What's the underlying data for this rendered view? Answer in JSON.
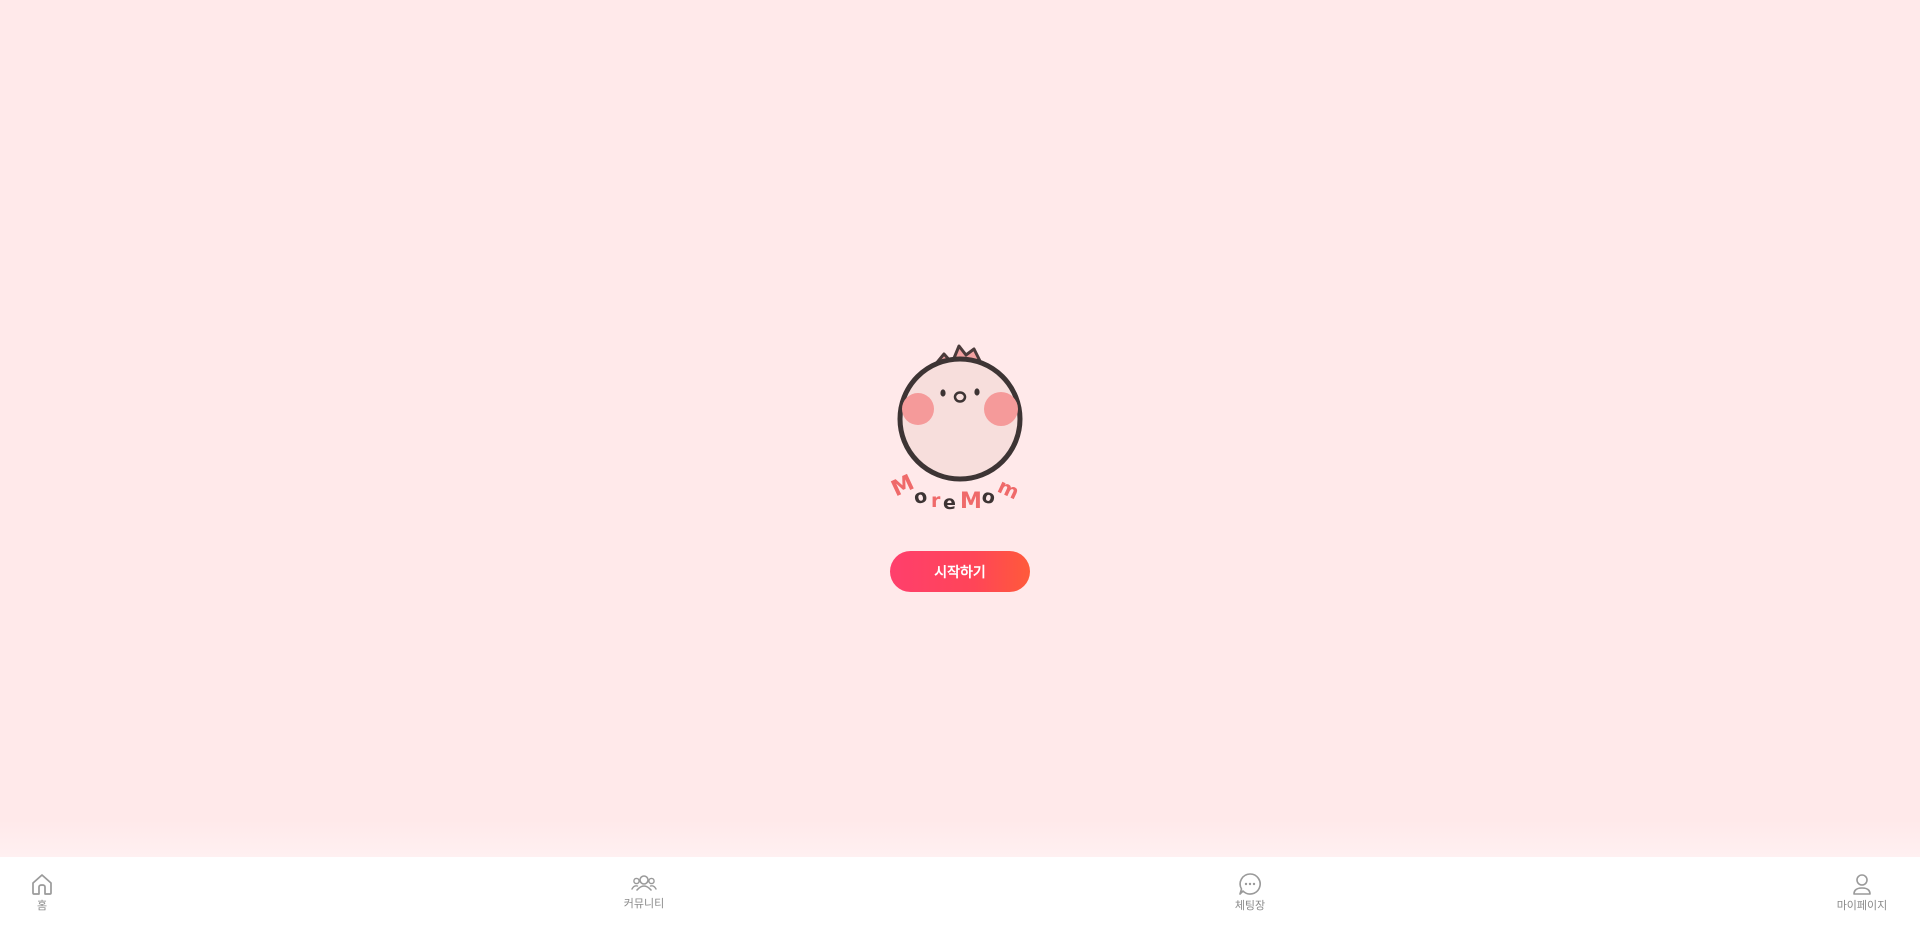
{
  "app": {
    "logo_text": "MoreMom",
    "background_color": "#ffe9ea"
  },
  "main": {
    "start_button_label": "시작하기",
    "accent_color": "#ff4558"
  },
  "bottom_nav": {
    "items": [
      {
        "label": "홈",
        "icon": "home-icon"
      },
      {
        "label": "커뮤니티",
        "icon": "people-icon"
      },
      {
        "label": "체팅장",
        "icon": "chat-bubble-icon"
      },
      {
        "label": "마이페이지",
        "icon": "user-icon"
      }
    ]
  }
}
